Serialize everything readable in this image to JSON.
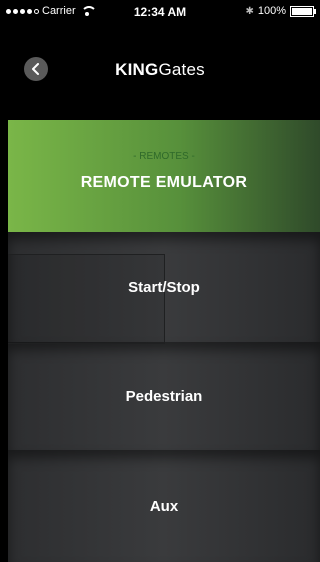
{
  "status_bar": {
    "carrier": "Carrier",
    "time": "12:34 AM",
    "battery": "100%"
  },
  "header": {
    "logo_bold": "KING",
    "logo_light": "Gates"
  },
  "banner": {
    "subtitle": "- REMOTES -",
    "title": "REMOTE EMULATOR"
  },
  "buttons": [
    {
      "label": "Start/Stop"
    },
    {
      "label": "Pedestrian"
    },
    {
      "label": "Aux"
    }
  ],
  "colors": {
    "banner_start": "#7ab648",
    "banner_end": "#2f4a2a",
    "button_bg": "#333436"
  }
}
